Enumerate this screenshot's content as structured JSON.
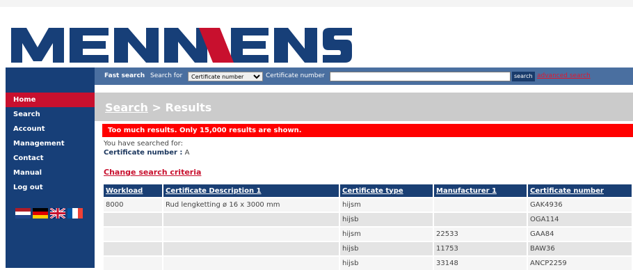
{
  "logo": {
    "text": "MENNENS",
    "color": "#173f78",
    "accent": "#c8102e"
  },
  "sidebar": {
    "items": [
      {
        "label": "Home",
        "active": true
      },
      {
        "label": "Search"
      },
      {
        "label": "Account"
      },
      {
        "label": "Management"
      },
      {
        "label": "Contact"
      },
      {
        "label": "Manual"
      },
      {
        "label": "Log out"
      }
    ],
    "flags": [
      "dutch-flag-icon",
      "german-flag-icon",
      "uk-flag-icon",
      "french-flag-icon"
    ]
  },
  "fast_search": {
    "title": "Fast search",
    "search_for_label": "Search for",
    "select_value": "Certificate number",
    "field_label": "Certificate number",
    "input_value": "",
    "button_label": "search",
    "advanced_label": "advanced search"
  },
  "heading": {
    "link": "Search",
    "rest": "> Results"
  },
  "error_message": "Too much results. Only 15,000 results are shown.",
  "searched": {
    "intro": "You have searched for:",
    "label": "Certificate number :",
    "value": "A"
  },
  "change_criteria": "Change search criteria",
  "table": {
    "headers": [
      "Workload",
      "Certificate Description 1",
      "Certificate type",
      "Manufacturer 1",
      "Certificate number"
    ],
    "rows": [
      [
        "8000",
        "Rud lengketting ø 16 x 3000 mm",
        "hijsm",
        "",
        "GAK4936"
      ],
      [
        "",
        "",
        "hijsb",
        "",
        "OGA114"
      ],
      [
        "",
        "",
        "hijsm",
        "22533",
        "GAA84"
      ],
      [
        "",
        "",
        "hijsb",
        "11753",
        "BAW36"
      ],
      [
        "",
        "",
        "hijsb",
        "33148",
        "ANCP2259"
      ]
    ]
  }
}
